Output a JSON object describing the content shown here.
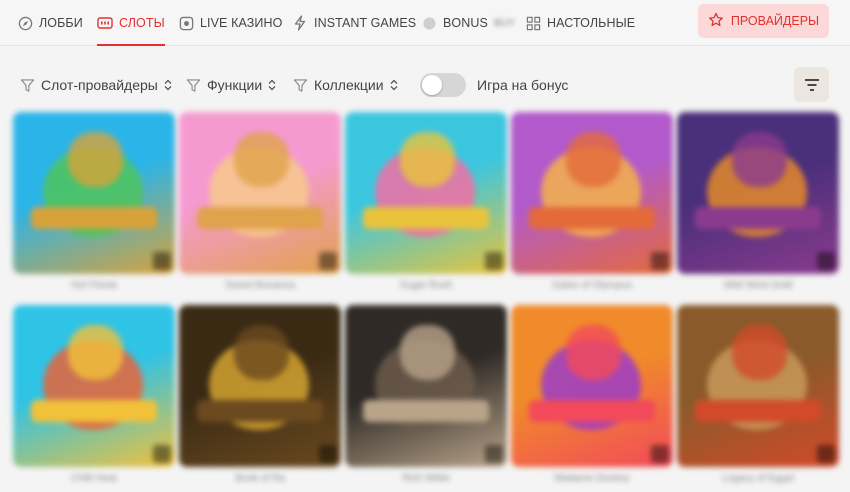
{
  "nav": {
    "items": [
      {
        "label": "ЛОББИ",
        "icon": "compass-icon"
      },
      {
        "label": "СЛОТЫ",
        "icon": "slot-machine-icon",
        "active": true
      },
      {
        "label": "LIVE КАЗИНО",
        "icon": "live-casino-icon"
      },
      {
        "label": "INSTANT GAMES",
        "icon": "lightning-icon"
      },
      {
        "label": "BONUS",
        "icon": "bonus-icon",
        "badge": "BUY"
      },
      {
        "label": "НАСТОЛЬНЫЕ",
        "icon": "grid-icon"
      }
    ],
    "providers_label": "ПРОВАЙДЕРЫ",
    "providers_icon": "star-icon"
  },
  "filters": {
    "items": [
      {
        "label": "Слот-провайдеры"
      },
      {
        "label": "Функции"
      },
      {
        "label": "Коллекции"
      }
    ],
    "bonus_toggle_label": "Игра на бонус",
    "bonus_toggle_on": false,
    "sort_icon": "sort-lines-icon"
  },
  "games": [
    {
      "title": "Hot Fiesta",
      "colors": [
        "#2bb4e8",
        "#4fc45a",
        "#d8a23a"
      ]
    },
    {
      "title": "Sweet Bonanza",
      "colors": [
        "#f59ad0",
        "#f7c98c",
        "#e0a24b"
      ]
    },
    {
      "title": "Sugar Rush",
      "colors": [
        "#3bc6e0",
        "#f36fa2",
        "#e9c43b"
      ]
    },
    {
      "title": "Gates of Olympus",
      "colors": [
        "#b25acb",
        "#f4b34a",
        "#e46a3a"
      ]
    },
    {
      "title": "Wild West Gold",
      "colors": [
        "#4a2f7a",
        "#e48a2a",
        "#8b3b8e"
      ]
    },
    {
      "title": "Chilli Heat",
      "colors": [
        "#2fc3e6",
        "#e8643a",
        "#f2c13a"
      ]
    },
    {
      "title": "Book of Ra",
      "colors": [
        "#3a2a14",
        "#d4a330",
        "#6b4a1f"
      ]
    },
    {
      "title": "Rich Wilde",
      "colors": [
        "#2f2a26",
        "#6b5a4b",
        "#b9a48a"
      ]
    },
    {
      "title": "Madame Destiny",
      "colors": [
        "#f08a2a",
        "#9b3cc9",
        "#f24a5a"
      ]
    },
    {
      "title": "Legacy of Egypt",
      "colors": [
        "#8a5a2a",
        "#c89a5a",
        "#d24a2a"
      ]
    }
  ]
}
